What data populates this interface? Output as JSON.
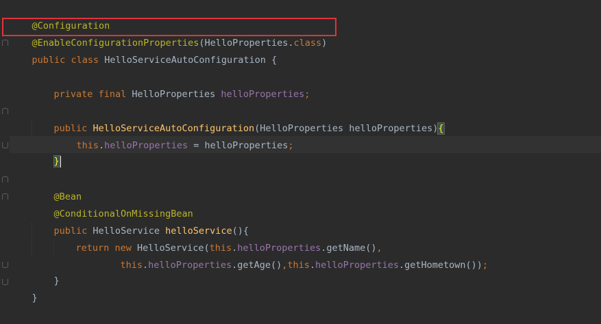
{
  "editor": {
    "lines": [
      [
        "@Configuration"
      ],
      [
        "@EnableConfigurationProperties",
        "(HelloProperties.",
        "class",
        ")"
      ],
      [
        "public",
        " ",
        "class",
        " HelloServiceAutoConfiguration {"
      ],
      [],
      [
        "private",
        " ",
        "final",
        " HelloProperties ",
        "helloProperties",
        ";"
      ],
      [],
      [
        "public",
        " ",
        "HelloServiceAutoConfiguration",
        "(HelloProperties helloProperties)",
        "{"
      ],
      [
        "this",
        ".",
        "helloProperties",
        " = helloProperties",
        ";"
      ],
      [
        "}"
      ],
      [],
      [
        "@Bean"
      ],
      [
        "@ConditionalOnMissingBean"
      ],
      [
        "public",
        " HelloService ",
        "helloService",
        "(){"
      ],
      [
        "return",
        " ",
        "new",
        " HelloService(",
        "this",
        ".",
        "helloProperties",
        ".getName()",
        ","
      ],
      [
        "this",
        ".",
        "helloProperties",
        ".getAge()",
        ",",
        "this",
        ".",
        "helloProperties",
        ".getHometown())",
        ";"
      ],
      [
        "}"
      ],
      [
        "}"
      ]
    ]
  }
}
